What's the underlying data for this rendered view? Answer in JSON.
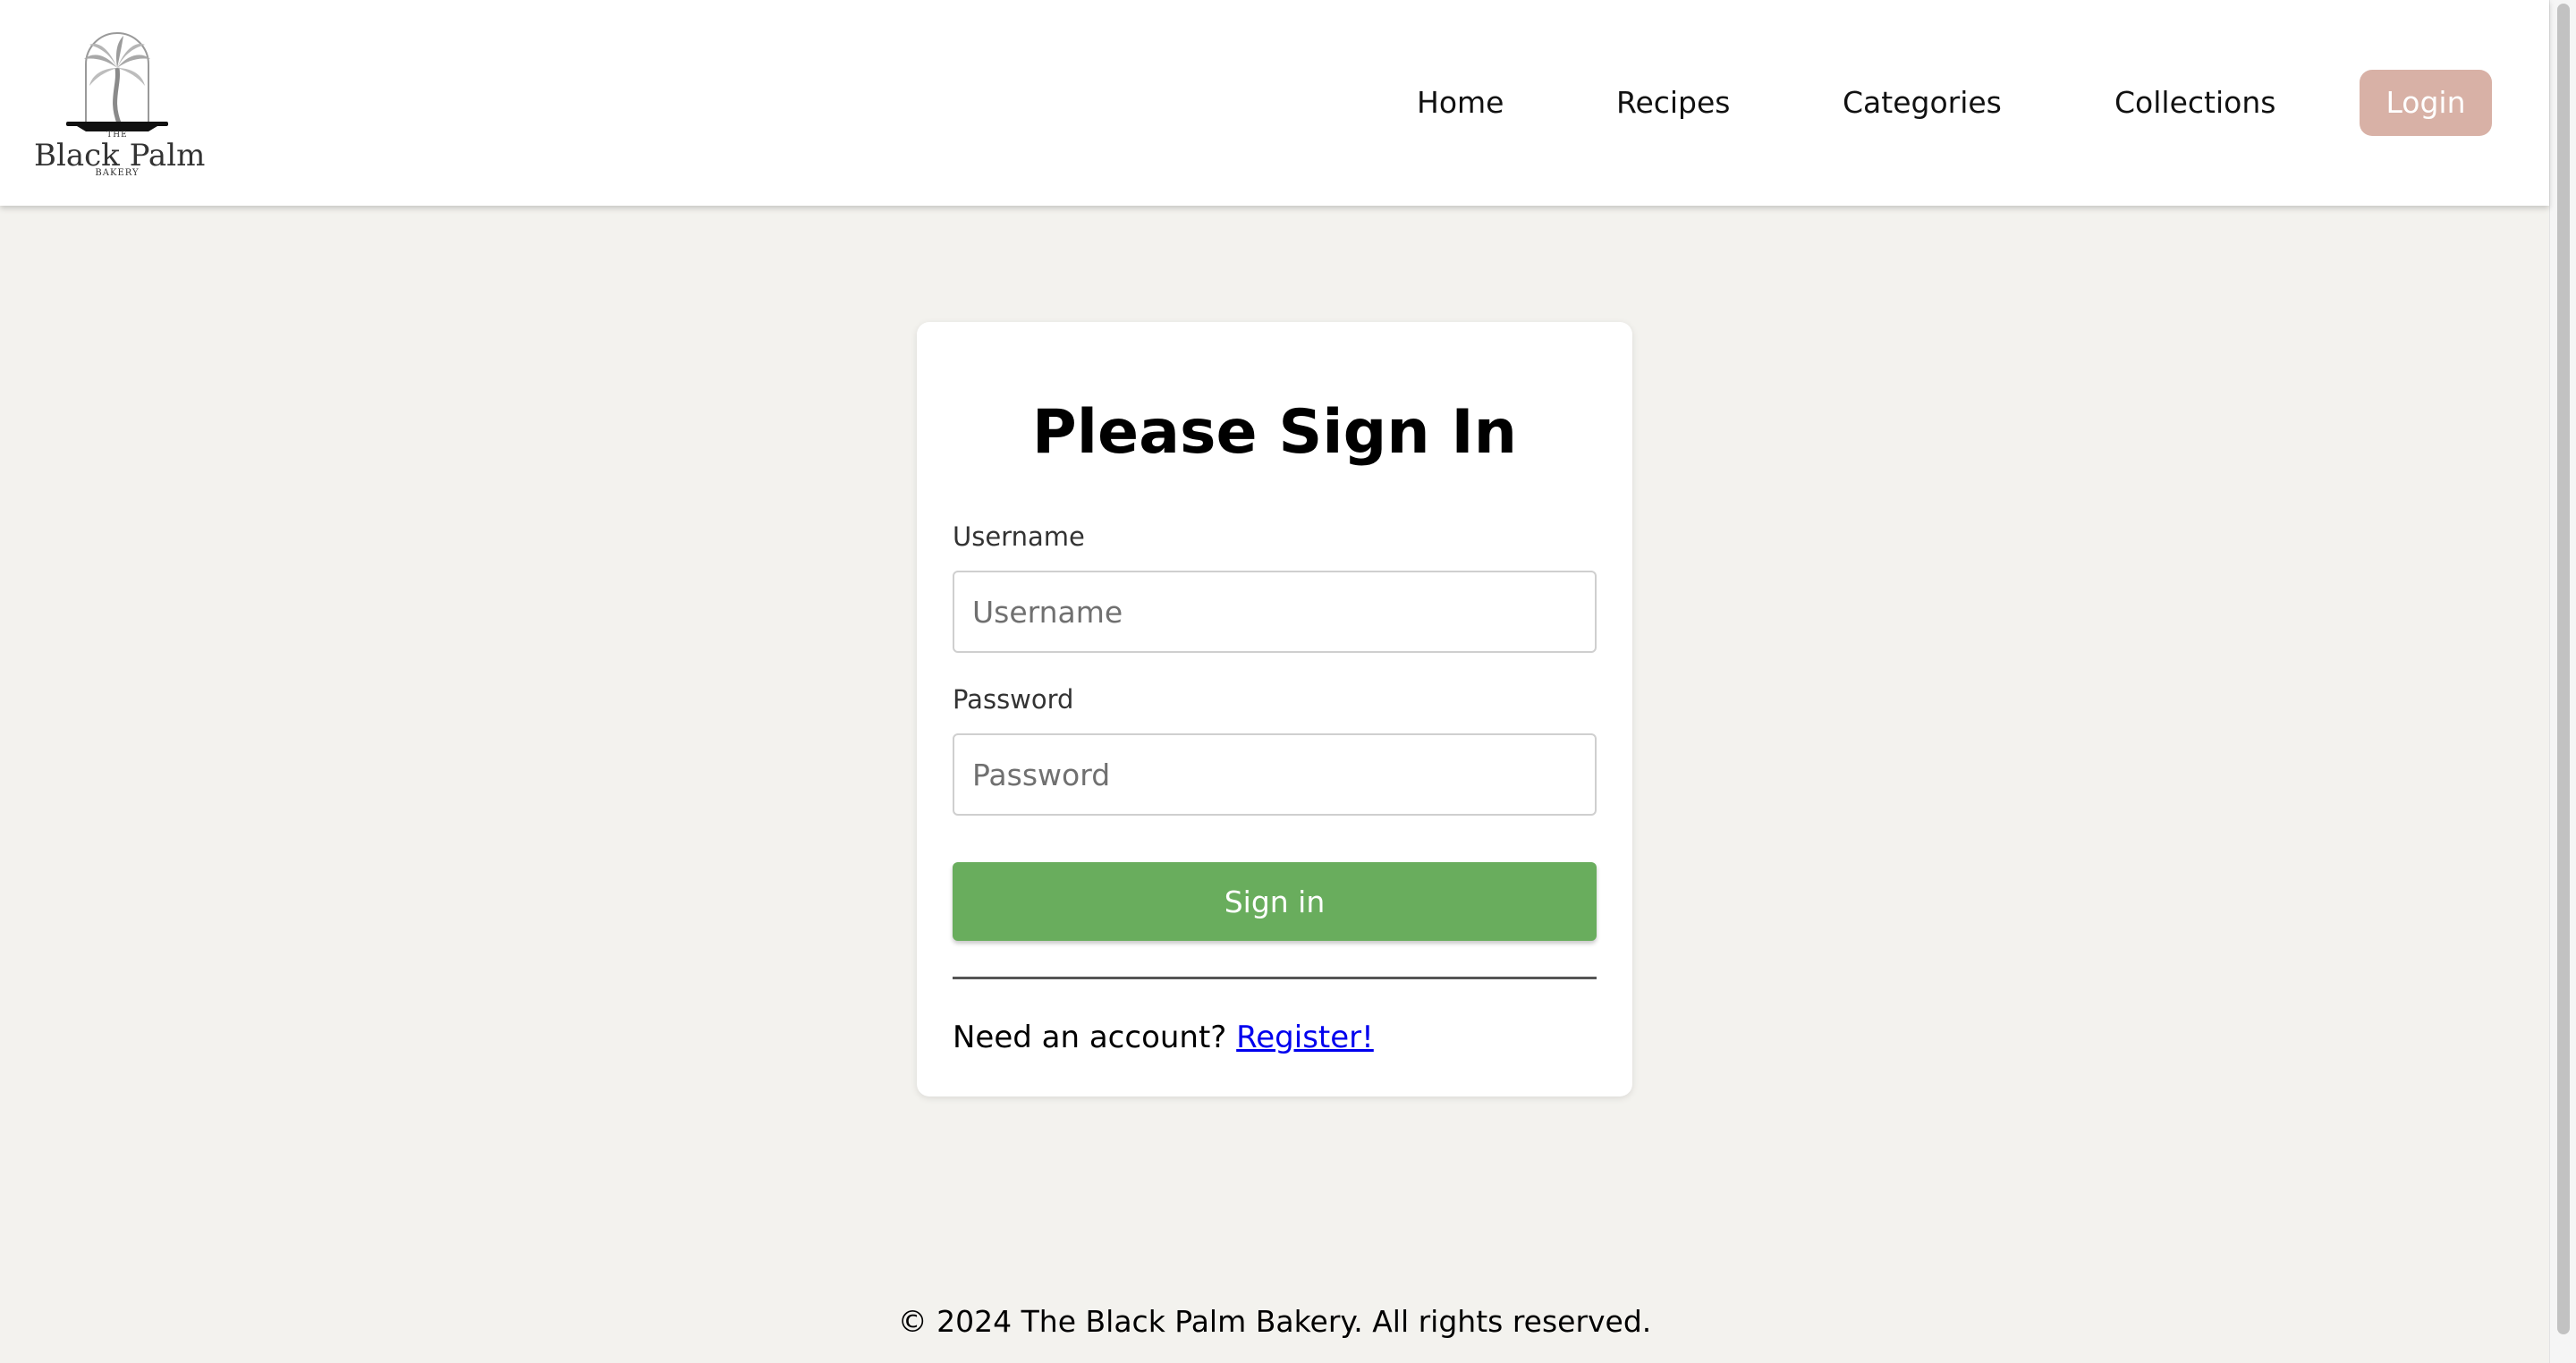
{
  "brand": {
    "top": "THE",
    "name": "Black Palm",
    "sub": "BAKERY",
    "icon": "palm-tree-icon"
  },
  "nav": {
    "home": "Home",
    "recipes": "Recipes",
    "categories": "Categories",
    "collections": "Collections",
    "login": "Login"
  },
  "form": {
    "title": "Please Sign In",
    "username_label": "Username",
    "username_placeholder": "Username",
    "password_label": "Password",
    "password_placeholder": "Password",
    "submit_label": "Sign in",
    "register_prompt": "Need an account?",
    "register_link": "Register!"
  },
  "footer": {
    "text": "© 2024 The Black Palm Bakery. All rights reserved."
  },
  "colors": {
    "background": "#f3f2ee",
    "login_button": "#d8b1a6",
    "signin_button": "#69ad5d",
    "link": "#0000ee"
  }
}
